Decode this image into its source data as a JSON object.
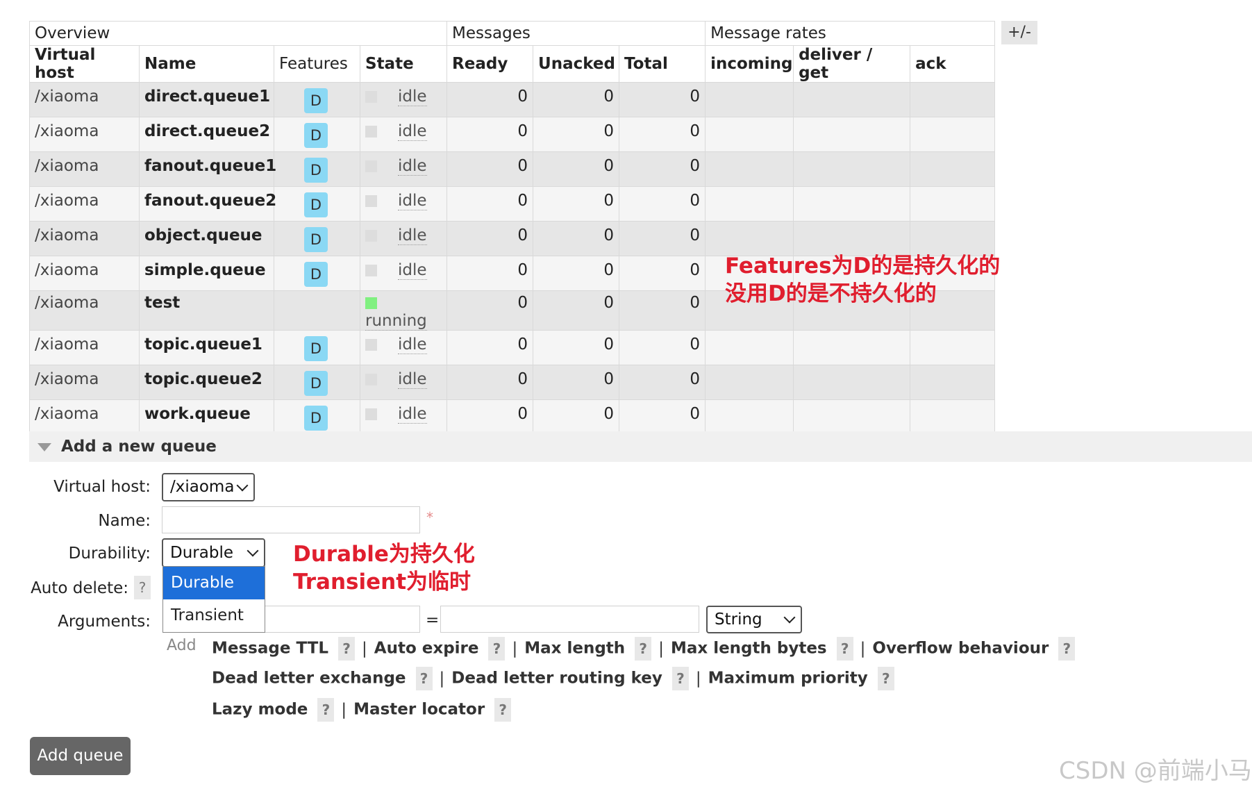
{
  "table": {
    "group_headers": [
      "Overview",
      "Messages",
      "Message rates"
    ],
    "toggle_label": "+/-",
    "columns": [
      "Virtual host",
      "Name",
      "Features",
      "State",
      "Ready",
      "Unacked",
      "Total",
      "incoming",
      "deliver / get",
      "ack"
    ],
    "rows": [
      {
        "vhost": "/xiaoma",
        "name": "direct.queue1",
        "feature": "D",
        "state": "idle",
        "ready": "0",
        "unacked": "0",
        "total": "0"
      },
      {
        "vhost": "/xiaoma",
        "name": "direct.queue2",
        "feature": "D",
        "state": "idle",
        "ready": "0",
        "unacked": "0",
        "total": "0"
      },
      {
        "vhost": "/xiaoma",
        "name": "fanout.queue1",
        "feature": "D",
        "state": "idle",
        "ready": "0",
        "unacked": "0",
        "total": "0"
      },
      {
        "vhost": "/xiaoma",
        "name": "fanout.queue2",
        "feature": "D",
        "state": "idle",
        "ready": "0",
        "unacked": "0",
        "total": "0"
      },
      {
        "vhost": "/xiaoma",
        "name": "object.queue",
        "feature": "D",
        "state": "idle",
        "ready": "0",
        "unacked": "0",
        "total": "0"
      },
      {
        "vhost": "/xiaoma",
        "name": "simple.queue",
        "feature": "D",
        "state": "idle",
        "ready": "0",
        "unacked": "0",
        "total": "0"
      },
      {
        "vhost": "/xiaoma",
        "name": "test",
        "feature": "",
        "state": "running",
        "ready": "0",
        "unacked": "0",
        "total": "0"
      },
      {
        "vhost": "/xiaoma",
        "name": "topic.queue1",
        "feature": "D",
        "state": "idle",
        "ready": "0",
        "unacked": "0",
        "total": "0"
      },
      {
        "vhost": "/xiaoma",
        "name": "topic.queue2",
        "feature": "D",
        "state": "idle",
        "ready": "0",
        "unacked": "0",
        "total": "0"
      },
      {
        "vhost": "/xiaoma",
        "name": "work.queue",
        "feature": "D",
        "state": "idle",
        "ready": "0",
        "unacked": "0",
        "total": "0"
      }
    ]
  },
  "annotations": {
    "features_line1": "Features为D的是持久化的",
    "features_line2": "没用D的是不持久化的",
    "durable_line1": "Durable为持久化",
    "durable_line2": "Transient为临时"
  },
  "add_queue": {
    "section_title": "Add a new queue",
    "virtual_host_label": "Virtual host:",
    "virtual_host_value": "/xiaoma",
    "name_label": "Name:",
    "name_value": "",
    "required_mark": "*",
    "durability_label": "Durability:",
    "durability_value": "Durable",
    "durability_options": [
      "Durable",
      "Transient"
    ],
    "auto_delete_label": "Auto delete:",
    "arguments_label": "Arguments:",
    "arguments_equals": "=",
    "argument_type": "String",
    "add_link": "Add",
    "help_glyph": "?",
    "arg_links_row1": [
      "Message TTL",
      "Auto expire",
      "Max length",
      "Max length bytes",
      "Overflow behaviour"
    ],
    "arg_links_row2": [
      "Dead letter exchange",
      "Dead letter routing key",
      "Maximum priority"
    ],
    "arg_links_row3": [
      "Lazy mode",
      "Master locator"
    ],
    "separator": "|",
    "submit_label": "Add queue"
  },
  "watermark": "CSDN @前端小马"
}
